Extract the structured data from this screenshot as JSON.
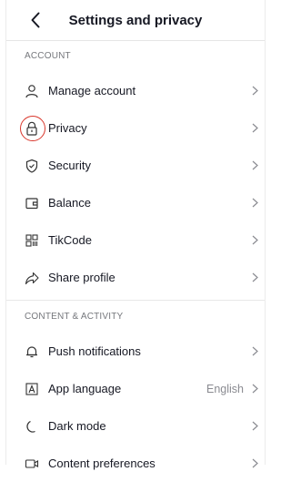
{
  "header": {
    "title": "Settings and privacy",
    "back_icon": "chevron-left-icon"
  },
  "sections": [
    {
      "title": "ACCOUNT",
      "items": [
        {
          "label": "Manage account",
          "icon": "person-icon"
        },
        {
          "label": "Privacy",
          "icon": "lock-icon",
          "annotated": true
        },
        {
          "label": "Security",
          "icon": "shield-icon"
        },
        {
          "label": "Balance",
          "icon": "wallet-icon"
        },
        {
          "label": "TikCode",
          "icon": "qr-code-icon"
        },
        {
          "label": "Share profile",
          "icon": "share-icon"
        }
      ]
    },
    {
      "title": "CONTENT & ACTIVITY",
      "items": [
        {
          "label": "Push notifications",
          "icon": "bell-icon"
        },
        {
          "label": "App language",
          "icon": "language-icon",
          "value": "English"
        },
        {
          "label": "Dark mode",
          "icon": "moon-icon"
        },
        {
          "label": "Content preferences",
          "icon": "video-icon"
        }
      ]
    }
  ],
  "colors": {
    "annotation": "#d9362b",
    "text": "#161823",
    "secondary_text": "#75777c"
  }
}
